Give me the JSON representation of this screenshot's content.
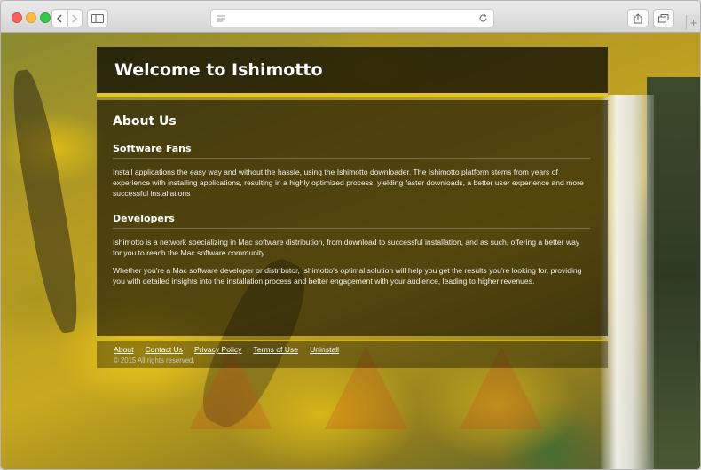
{
  "page": {
    "title": "Welcome to Ishimotto"
  },
  "about": {
    "heading": "About Us",
    "sections": [
      {
        "title": "Software Fans",
        "paragraphs": [
          "Install applications the easy way and without the hassle, using the Ishimotto downloader. The Ishimotto platform stems from years of experience with installing applications, resulting in a highly optimized process, yielding faster downloads, a better user experience and more successful installations"
        ]
      },
      {
        "title": "Developers",
        "paragraphs": [
          "Ishimotto is a network specializing in Mac software distribution, from download to successful installation, and as such, offering a better way for you to reach the Mac software community.",
          "Whether you're a Mac software developer or distributor, Ishimotto's optimal solution will help you get the results you're looking for, providing you with detailed insights into the installation process and better engagement with your audience, leading to higher revenues."
        ]
      }
    ]
  },
  "footer": {
    "links": [
      "About",
      "Contact Us",
      "Privacy Policy",
      "Terms of Use",
      "Uninstall"
    ],
    "copyright": "© 2015 All rights reserved."
  },
  "colors": {
    "accent": "#e5c61a"
  }
}
